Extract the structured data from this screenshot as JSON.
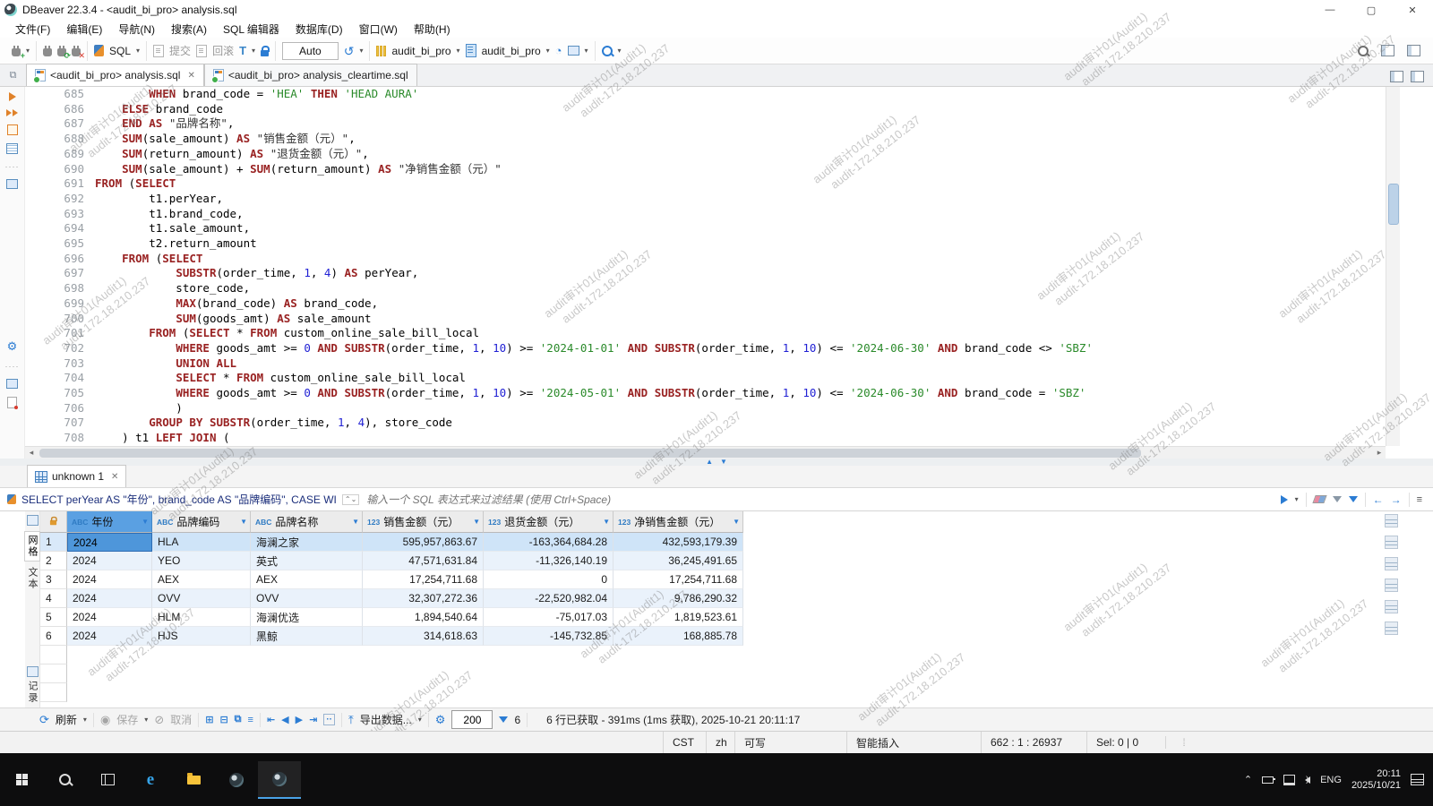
{
  "window": {
    "title": "DBeaver 22.3.4 - <audit_bi_pro> analysis.sql",
    "controls": {
      "minimize": "—",
      "maximize": "▢",
      "close": "✕"
    }
  },
  "menu": {
    "items": [
      "文件(F)",
      "编辑(E)",
      "导航(N)",
      "搜索(A)",
      "SQL 编辑器",
      "数据库(D)",
      "窗口(W)",
      "帮助(H)"
    ]
  },
  "toolbar": {
    "sql_label": "SQL",
    "commit_label": "提交",
    "rollback_label": "回滚",
    "auto_label": "Auto",
    "database": "audit_bi_pro",
    "schema": "audit_bi_pro"
  },
  "tabs": [
    {
      "label": "<audit_bi_pro> analysis.sql"
    },
    {
      "label": "<audit_bi_pro> analysis_cleartime.sql"
    }
  ],
  "watermark": {
    "line1": "audit审计01(Audit1)",
    "line2": "audit-172.18.210.237"
  },
  "editor": {
    "lines": [
      {
        "n": 685,
        "t": [
          [
            "p",
            "        "
          ],
          [
            "k",
            "WHEN"
          ],
          [
            "p",
            " brand_code = "
          ],
          [
            "s",
            "'HEA'"
          ],
          [
            "p",
            " "
          ],
          [
            "k",
            "THEN"
          ],
          [
            "p",
            " "
          ],
          [
            "s",
            "'HEAD AURA'"
          ]
        ]
      },
      {
        "n": 686,
        "t": [
          [
            "p",
            "    "
          ],
          [
            "k",
            "ELSE"
          ],
          [
            "p",
            " brand_code"
          ]
        ]
      },
      {
        "n": 687,
        "t": [
          [
            "p",
            "    "
          ],
          [
            "k",
            "END"
          ],
          [
            "p",
            " "
          ],
          [
            "k",
            "AS"
          ],
          [
            "p",
            " "
          ],
          [
            "d",
            "\"品牌名称\""
          ],
          [
            "p",
            ","
          ]
        ]
      },
      {
        "n": 688,
        "t": [
          [
            "p",
            "    "
          ],
          [
            "k",
            "SUM"
          ],
          [
            "p",
            "(sale_amount) "
          ],
          [
            "k",
            "AS"
          ],
          [
            "p",
            " "
          ],
          [
            "d",
            "\"销售金额（元）\""
          ],
          [
            "p",
            ","
          ]
        ]
      },
      {
        "n": 689,
        "t": [
          [
            "p",
            "    "
          ],
          [
            "k",
            "SUM"
          ],
          [
            "p",
            "(return_amount) "
          ],
          [
            "k",
            "AS"
          ],
          [
            "p",
            " "
          ],
          [
            "d",
            "\"退货金额（元）\""
          ],
          [
            "p",
            ","
          ]
        ]
      },
      {
        "n": 690,
        "t": [
          [
            "p",
            "    "
          ],
          [
            "k",
            "SUM"
          ],
          [
            "p",
            "(sale_amount) + "
          ],
          [
            "k",
            "SUM"
          ],
          [
            "p",
            "(return_amount) "
          ],
          [
            "k",
            "AS"
          ],
          [
            "p",
            " "
          ],
          [
            "d",
            "\"净销售金额（元）\""
          ]
        ]
      },
      {
        "n": 691,
        "t": [
          [
            "k",
            "FROM"
          ],
          [
            "p",
            " ("
          ],
          [
            "k",
            "SELECT"
          ]
        ]
      },
      {
        "n": 692,
        "t": [
          [
            "p",
            "        t1.perYear,"
          ]
        ]
      },
      {
        "n": 693,
        "t": [
          [
            "p",
            "        t1.brand_code,"
          ]
        ]
      },
      {
        "n": 694,
        "t": [
          [
            "p",
            "        t1.sale_amount,"
          ]
        ]
      },
      {
        "n": 695,
        "t": [
          [
            "p",
            "        t2.return_amount"
          ]
        ]
      },
      {
        "n": 696,
        "t": [
          [
            "p",
            "    "
          ],
          [
            "k",
            "FROM"
          ],
          [
            "p",
            " ("
          ],
          [
            "k",
            "SELECT"
          ]
        ]
      },
      {
        "n": 697,
        "t": [
          [
            "p",
            "            "
          ],
          [
            "k",
            "SUBSTR"
          ],
          [
            "p",
            "(order_time, "
          ],
          [
            "n",
            "1"
          ],
          [
            "p",
            ", "
          ],
          [
            "n",
            "4"
          ],
          [
            "p",
            ") "
          ],
          [
            "k",
            "AS"
          ],
          [
            "p",
            " perYear,"
          ]
        ]
      },
      {
        "n": 698,
        "t": [
          [
            "p",
            "            store_code,"
          ]
        ]
      },
      {
        "n": 699,
        "t": [
          [
            "p",
            "            "
          ],
          [
            "k",
            "MAX"
          ],
          [
            "p",
            "(brand_code) "
          ],
          [
            "k",
            "AS"
          ],
          [
            "p",
            " brand_code,"
          ]
        ]
      },
      {
        "n": 700,
        "t": [
          [
            "p",
            "            "
          ],
          [
            "k",
            "SUM"
          ],
          [
            "p",
            "(goods_amt) "
          ],
          [
            "k",
            "AS"
          ],
          [
            "p",
            " sale_amount"
          ]
        ]
      },
      {
        "n": 701,
        "t": [
          [
            "p",
            "        "
          ],
          [
            "k",
            "FROM"
          ],
          [
            "p",
            " ("
          ],
          [
            "k",
            "SELECT"
          ],
          [
            "p",
            " * "
          ],
          [
            "k",
            "FROM"
          ],
          [
            "p",
            " custom_online_sale_bill_local"
          ]
        ]
      },
      {
        "n": 702,
        "t": [
          [
            "p",
            "            "
          ],
          [
            "k",
            "WHERE"
          ],
          [
            "p",
            " goods_amt >= "
          ],
          [
            "n",
            "0"
          ],
          [
            "p",
            " "
          ],
          [
            "k",
            "AND"
          ],
          [
            "p",
            " "
          ],
          [
            "k",
            "SUBSTR"
          ],
          [
            "p",
            "(order_time, "
          ],
          [
            "n",
            "1"
          ],
          [
            "p",
            ", "
          ],
          [
            "n",
            "10"
          ],
          [
            "p",
            ") >= "
          ],
          [
            "s",
            "'2024-01-01'"
          ],
          [
            "p",
            " "
          ],
          [
            "k",
            "AND"
          ],
          [
            "p",
            " "
          ],
          [
            "k",
            "SUBSTR"
          ],
          [
            "p",
            "(order_time, "
          ],
          [
            "n",
            "1"
          ],
          [
            "p",
            ", "
          ],
          [
            "n",
            "10"
          ],
          [
            "p",
            ") <= "
          ],
          [
            "s",
            "'2024-06-30'"
          ],
          [
            "p",
            " "
          ],
          [
            "k",
            "AND"
          ],
          [
            "p",
            " brand_code <> "
          ],
          [
            "s",
            "'SBZ'"
          ]
        ]
      },
      {
        "n": 703,
        "t": [
          [
            "p",
            "            "
          ],
          [
            "k",
            "UNION ALL"
          ]
        ]
      },
      {
        "n": 704,
        "t": [
          [
            "p",
            "            "
          ],
          [
            "k",
            "SELECT"
          ],
          [
            "p",
            " * "
          ],
          [
            "k",
            "FROM"
          ],
          [
            "p",
            " custom_online_sale_bill_local"
          ]
        ]
      },
      {
        "n": 705,
        "t": [
          [
            "p",
            "            "
          ],
          [
            "k",
            "WHERE"
          ],
          [
            "p",
            " goods_amt >= "
          ],
          [
            "n",
            "0"
          ],
          [
            "p",
            " "
          ],
          [
            "k",
            "AND"
          ],
          [
            "p",
            " "
          ],
          [
            "k",
            "SUBSTR"
          ],
          [
            "p",
            "(order_time, "
          ],
          [
            "n",
            "1"
          ],
          [
            "p",
            ", "
          ],
          [
            "n",
            "10"
          ],
          [
            "p",
            ") >= "
          ],
          [
            "s",
            "'2024-05-01'"
          ],
          [
            "p",
            " "
          ],
          [
            "k",
            "AND"
          ],
          [
            "p",
            " "
          ],
          [
            "k",
            "SUBSTR"
          ],
          [
            "p",
            "(order_time, "
          ],
          [
            "n",
            "1"
          ],
          [
            "p",
            ", "
          ],
          [
            "n",
            "10"
          ],
          [
            "p",
            ") <= "
          ],
          [
            "s",
            "'2024-06-30'"
          ],
          [
            "p",
            " "
          ],
          [
            "k",
            "AND"
          ],
          [
            "p",
            " brand_code = "
          ],
          [
            "s",
            "'SBZ'"
          ]
        ]
      },
      {
        "n": 706,
        "t": [
          [
            "p",
            "            )"
          ]
        ]
      },
      {
        "n": 707,
        "t": [
          [
            "p",
            "        "
          ],
          [
            "k",
            "GROUP BY"
          ],
          [
            "p",
            " "
          ],
          [
            "k",
            "SUBSTR"
          ],
          [
            "p",
            "(order_time, "
          ],
          [
            "n",
            "1"
          ],
          [
            "p",
            ", "
          ],
          [
            "n",
            "4"
          ],
          [
            "p",
            "), store_code"
          ]
        ]
      },
      {
        "n": 708,
        "t": [
          [
            "p",
            "    ) t1 "
          ],
          [
            "k",
            "LEFT JOIN"
          ],
          [
            "p",
            " ("
          ]
        ]
      }
    ]
  },
  "results": {
    "tab": "unknown 1",
    "filter_query": "SELECT perYear AS \"年份\", brand_code AS \"品牌编码\", CASE WI",
    "filter_placeholder": "输入一个 SQL 表达式来过滤结果 (使用 Ctrl+Space)",
    "view_tabs": [
      "网格",
      "文本"
    ],
    "record_label": "记录",
    "columns": [
      {
        "type": "ABC",
        "label": "年份"
      },
      {
        "type": "ABC",
        "label": "品牌编码"
      },
      {
        "type": "ABC",
        "label": "品牌名称"
      },
      {
        "type": "123",
        "label": "销售金额（元）"
      },
      {
        "type": "123",
        "label": "退货金额（元）"
      },
      {
        "type": "123",
        "label": "净销售金额（元）"
      }
    ],
    "rows": [
      [
        "2024",
        "HLA",
        "海澜之家",
        "595,957,863.67",
        "-163,364,684.28",
        "432,593,179.39"
      ],
      [
        "2024",
        "YEO",
        "英式",
        "47,571,631.84",
        "-11,326,140.19",
        "36,245,491.65"
      ],
      [
        "2024",
        "AEX",
        "AEX",
        "17,254,711.68",
        "0",
        "17,254,711.68"
      ],
      [
        "2024",
        "OVV",
        "OVV",
        "32,307,272.36",
        "-22,520,982.04",
        "9,786,290.32"
      ],
      [
        "2024",
        "HLM",
        "海澜优选",
        "1,894,540.64",
        "-75,017.03",
        "1,819,523.61"
      ],
      [
        "2024",
        "HJS",
        "黑鲸",
        "314,618.63",
        "-145,732.85",
        "168,885.78"
      ]
    ],
    "toolbar": {
      "refresh_label": "刷新",
      "save_label": "保存",
      "cancel_label": "取消",
      "export_label": "导出数据...",
      "fetch_size": "200",
      "filter_count": "6",
      "status": "6 行已获取 - 391ms (1ms 获取), 2025-10-21 20:11:17"
    }
  },
  "statusbar": {
    "items": [
      "CST",
      "zh",
      "可写",
      "智能插入",
      "662 : 1 : 26937",
      "Sel: 0 | 0"
    ]
  },
  "taskbar": {
    "lang": "ENG",
    "time": "20:11",
    "date": "2025/10/21"
  }
}
